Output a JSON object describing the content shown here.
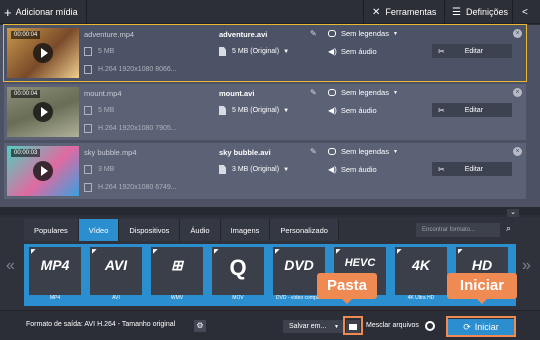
{
  "topbar": {
    "add_label": "Adicionar mídia",
    "tools_label": "Ferramentas",
    "settings_label": "Definições"
  },
  "files": [
    {
      "duration": "00:00:04",
      "name": "adventure.mp4",
      "size": "5 MB",
      "codec": "H.264 1920x1080 8066...",
      "out_name": "adventure.avi",
      "out_size": "5 MB (Original)",
      "subtitles": "Sem legendas",
      "audio": "Sem áudio",
      "edit": "Editar",
      "selected": true
    },
    {
      "duration": "00:00:04",
      "name": "mount.mp4",
      "size": "5 MB",
      "codec": "H.264 1920x1080 7905...",
      "out_name": "mount.avi",
      "out_size": "5 MB (Original)",
      "subtitles": "Sem legendas",
      "audio": "Sem áudio",
      "edit": "Editar",
      "selected": false
    },
    {
      "duration": "00:00:03",
      "name": "sky bubble.mp4",
      "size": "3 MB",
      "codec": "H.264 1920x1080 6749...",
      "out_name": "sky bubble.avi",
      "out_size": "3 MB (Original)",
      "subtitles": "Sem legendas",
      "audio": "Sem áudio",
      "edit": "Editar",
      "selected": false
    }
  ],
  "tabs": [
    "Populares",
    "Vídeo",
    "Dispositivos",
    "Áudio",
    "Imagens",
    "Personalizado"
  ],
  "active_tab": "Vídeo",
  "search_placeholder": "Encontrar formato...",
  "formats": [
    {
      "logo": "MP4",
      "label": "MP4"
    },
    {
      "logo": "AVI",
      "label": "AVI"
    },
    {
      "logo": "",
      "label": "WMV"
    },
    {
      "logo": "Q",
      "label": "MOV"
    },
    {
      "logo": "DVD",
      "label": "DVD - vídeo compati"
    },
    {
      "logo": "HEVC",
      "label": ""
    },
    {
      "logo": "4K",
      "label": "4K Ultra HD"
    },
    {
      "logo": "HD",
      "label": ""
    }
  ],
  "bottom": {
    "format_text": "Formato de saída: AVI H.264 - Tamanho original",
    "save_label": "Salvar em...",
    "merge_label": "Mesclar arquivos",
    "start_label": "Iniciar"
  },
  "callouts": {
    "folder": "Pasta",
    "start": "Iniciar"
  },
  "colors": {
    "accent": "#2b8ecf",
    "callout": "#ef8a52",
    "selection": "#e8b830"
  }
}
